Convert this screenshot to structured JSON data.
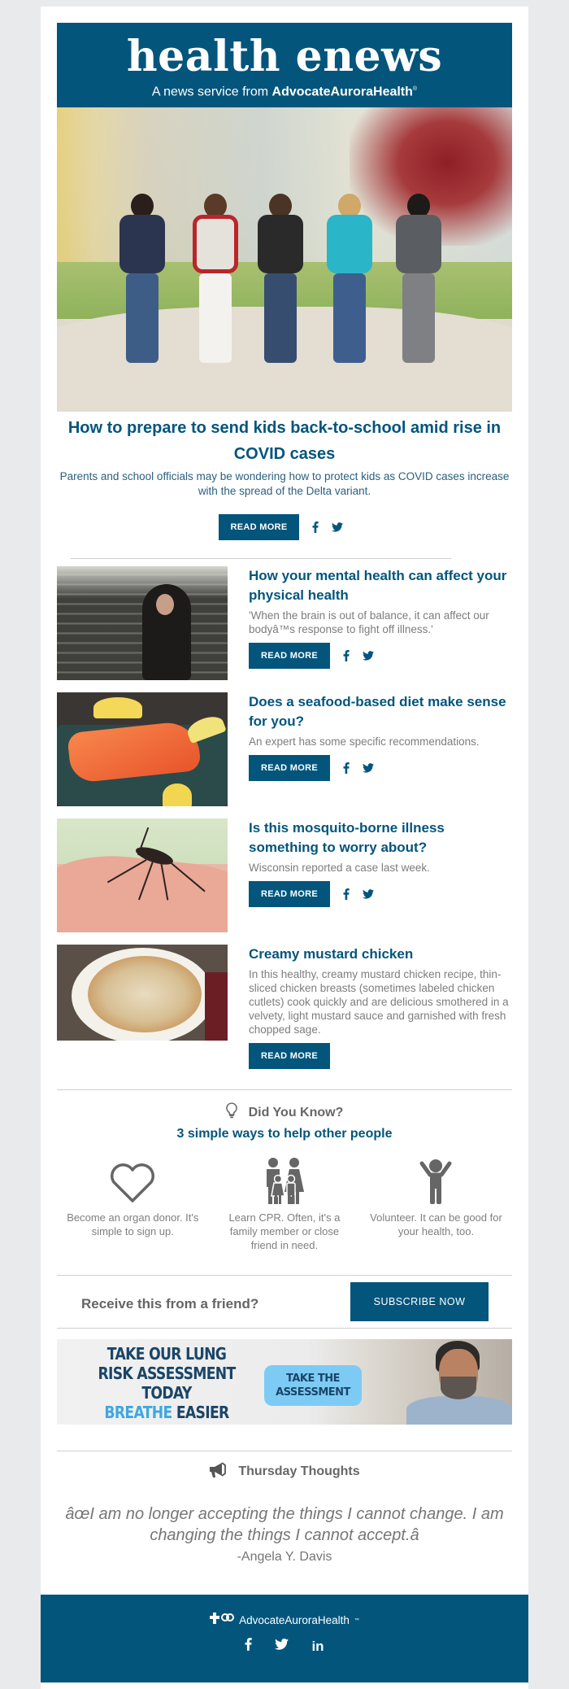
{
  "header": {
    "brand": "health enews",
    "tagline_prefix": "A news service from",
    "tagline_org": "AdvocateAuroraHealth",
    "tagline_mark": "®"
  },
  "colors": {
    "brand_navy": "#03557c",
    "text_gray": "#7d7d7d",
    "page_bg": "#e9eaeb",
    "banner_cta": "#7dcbf5"
  },
  "feature": {
    "image_alt": "Five kids with backpacks running toward school",
    "title": "How to prepare to send kids back-to-school amid rise in COVID cases",
    "description": "Parents and school officials may be wondering how to protect kids as COVID cases increase with the spread of the Delta variant.",
    "read_more": "READ MORE",
    "share": [
      "facebook-icon",
      "twitter-icon"
    ]
  },
  "articles": [
    {
      "image_alt": "Woman sitting on stairs looking anxious",
      "title": "How your mental health can affect your physical health",
      "description": "'When the brain is out of balance, it can affect our bodyâ™s response to fight off illness.'",
      "read_more": "READ MORE",
      "has_share": true
    },
    {
      "image_alt": "Salmon fillet with lemon and peppercorns",
      "title": "Does a seafood-based diet make sense for you?",
      "description": "An expert has some specific recommendations.",
      "read_more": "READ MORE",
      "has_share": true
    },
    {
      "image_alt": "Mosquito on skin",
      "title": "Is this mosquito-borne illness something to worry about?",
      "description": "Wisconsin reported a case last week.",
      "read_more": "READ MORE",
      "has_share": true
    },
    {
      "image_alt": "Creamy mustard chicken over pasta",
      "title": "Creamy mustard chicken",
      "description": "In this healthy, creamy mustard chicken recipe, thin-sliced chicken breasts (sometimes labeled chicken cutlets) cook quickly and are delicious smothered in a velvety, light mustard sauce and garnished with fresh chopped sage.",
      "read_more": "READ MORE",
      "has_share": false
    }
  ],
  "did_you_know": {
    "heading": "Did You Know?",
    "subheading": "3 simple ways to help other people",
    "items": [
      {
        "icon": "heart-icon",
        "text": "Become an organ donor. It's simple to sign up."
      },
      {
        "icon": "family-icon",
        "text": "Learn CPR. Often, it's a family member or close friend in need."
      },
      {
        "icon": "person-cheering-icon",
        "text": "Volunteer. It can be good for your health, too."
      }
    ]
  },
  "subscribe": {
    "prompt": "Receive this from a friend?",
    "button": "SUBSCRIBE NOW"
  },
  "banner": {
    "line1": "TAKE OUR LUNG",
    "line2": "RISK ASSESSMENT TODAY",
    "line3_highlight": "BREATHE",
    "line3_rest": " EASIER",
    "cta_line1": "TAKE THE",
    "cta_line2": "ASSESSMENT"
  },
  "thursday_thoughts": {
    "heading": "Thursday Thoughts",
    "quote": "âœI am no longer accepting the things I cannot change. I am changing the things I cannot accept.â",
    "author": "-Angela Y. Davis"
  },
  "footer": {
    "org": "AdvocateAuroraHealth",
    "mark": "™",
    "social": [
      "facebook-icon",
      "twitter-icon",
      "linkedin-icon"
    ],
    "linkedin_label": "in"
  }
}
